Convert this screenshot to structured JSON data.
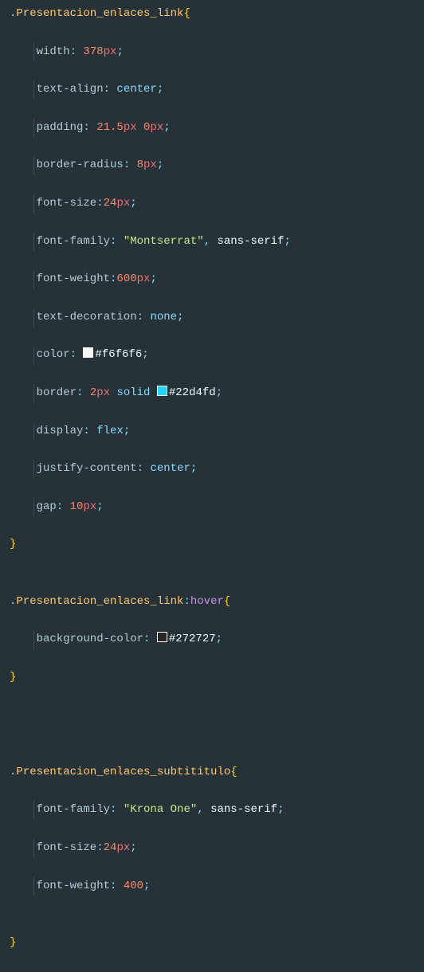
{
  "rules": [
    {
      "selector": ".Presentacion_enlaces_link",
      "declarations": [
        {
          "prop": "width",
          "tokens": [
            {
              "t": "num",
              "v": "378"
            },
            {
              "t": "unit",
              "v": "px"
            }
          ]
        },
        {
          "prop": "text-align",
          "tokens": [
            {
              "t": "kw",
              "v": "center"
            }
          ]
        },
        {
          "prop": "padding",
          "tokens": [
            {
              "t": "num",
              "v": "21.5"
            },
            {
              "t": "unit",
              "v": "px"
            },
            {
              "t": "sp"
            },
            {
              "t": "num",
              "v": "0"
            },
            {
              "t": "unit",
              "v": "px"
            }
          ]
        },
        {
          "prop": "border-radius",
          "tokens": [
            {
              "t": "num",
              "v": "8"
            },
            {
              "t": "unit",
              "v": "px"
            }
          ]
        },
        {
          "prop": "font-size",
          "nospace": true,
          "tokens": [
            {
              "t": "num",
              "v": "24"
            },
            {
              "t": "unit",
              "v": "px"
            }
          ]
        },
        {
          "prop": "font-family",
          "tokens": [
            {
              "t": "str",
              "v": "\"Montserrat\""
            },
            {
              "t": "punct",
              "v": ","
            },
            {
              "t": "sp"
            },
            {
              "t": "ident",
              "v": "sans-serif"
            }
          ]
        },
        {
          "prop": "font-weight",
          "nospace": true,
          "tokens": [
            {
              "t": "num",
              "v": "600"
            },
            {
              "t": "unit",
              "v": "px"
            }
          ]
        },
        {
          "prop": "text-decoration",
          "tokens": [
            {
              "t": "kw",
              "v": "none"
            }
          ]
        },
        {
          "prop": "color",
          "tokens": [
            {
              "t": "swatch",
              "v": "#f6f6f6"
            },
            {
              "t": "ident",
              "v": "#f6f6f6"
            }
          ]
        },
        {
          "prop": "border",
          "tokens": [
            {
              "t": "num",
              "v": "2"
            },
            {
              "t": "unit",
              "v": "px"
            },
            {
              "t": "sp"
            },
            {
              "t": "kw",
              "v": "solid"
            },
            {
              "t": "sp"
            },
            {
              "t": "swatch",
              "v": "#22d4fd"
            },
            {
              "t": "ident",
              "v": "#22d4fd"
            }
          ]
        },
        {
          "prop": "display",
          "tokens": [
            {
              "t": "kw",
              "v": "flex"
            }
          ]
        },
        {
          "prop": "justify-content",
          "tokens": [
            {
              "t": "kw",
              "v": "center"
            }
          ]
        },
        {
          "prop": "gap",
          "tokens": [
            {
              "t": "num",
              "v": "10"
            },
            {
              "t": "unit",
              "v": "px"
            }
          ]
        }
      ]
    },
    {
      "selector": ".Presentacion_enlaces_link",
      "pseudo": ":hover",
      "declarations": [
        {
          "prop": "background-color",
          "tokens": [
            {
              "t": "swatch",
              "v": "#272727"
            },
            {
              "t": "ident",
              "v": "#272727"
            }
          ]
        }
      ]
    },
    {
      "gap": 2,
      "selector": ".Presentacion_enlaces_subtititulo",
      "declarations": [
        {
          "prop": "font-family",
          "tokens": [
            {
              "t": "str",
              "v": "\"Krona One\""
            },
            {
              "t": "punct",
              "v": ","
            },
            {
              "t": "sp"
            },
            {
              "t": "ident",
              "v": "sans-serif"
            }
          ]
        },
        {
          "prop": "font-size",
          "nospace": true,
          "tokens": [
            {
              "t": "num",
              "v": "24"
            },
            {
              "t": "unit",
              "v": "px"
            }
          ]
        },
        {
          "prop": "font-weight",
          "tokens": [
            {
              "t": "num",
              "v": "400"
            }
          ]
        }
      ],
      "trailing_blank": true
    }
  ]
}
